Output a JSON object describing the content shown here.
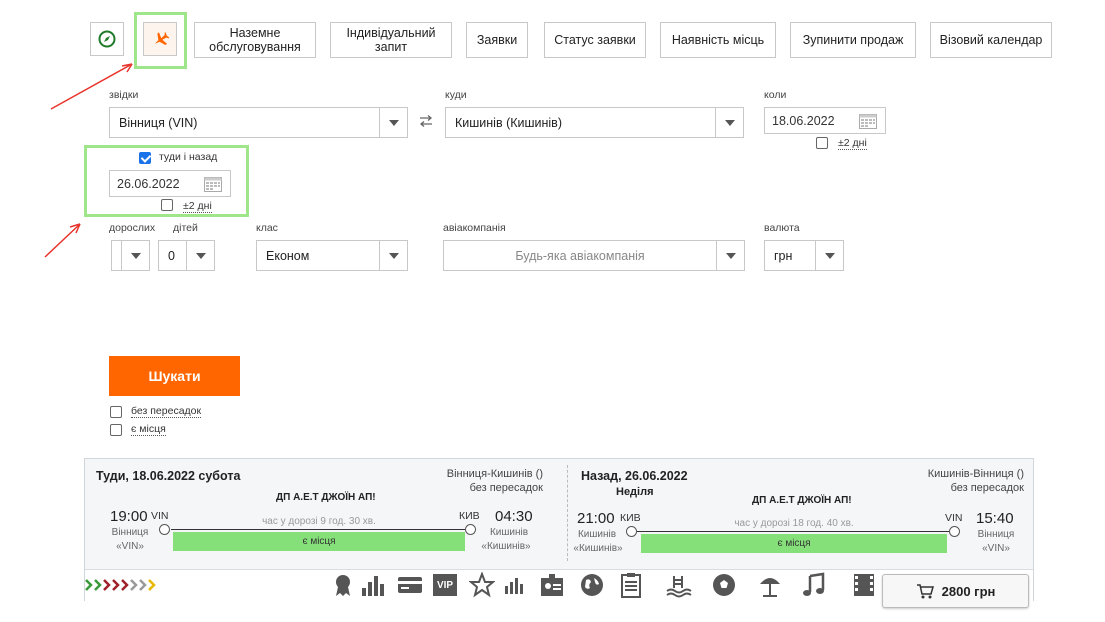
{
  "nav": {
    "ground": "Наземне обслуговування",
    "individual": "Індивідуальний запит",
    "requests": "Заявки",
    "status": "Статус заявки",
    "availability": "Наявність місць",
    "stop_sales": "Зупинити продаж",
    "visa": "Візовий календар"
  },
  "form": {
    "from_label": "звідки",
    "from_value": "Вінниця (VIN)",
    "to_label": "куди",
    "to_value": "Кишинів (Кишинів)",
    "when_label": "коли",
    "when_value": "18.06.2022",
    "flex_label": "±2 дні",
    "roundtrip_label": "туди і назад",
    "return_value": "26.06.2022",
    "return_flex_label": "±2 дні",
    "adults_label": "дорослих",
    "adults_value": "",
    "children_label": "дітей",
    "children_value": "0",
    "class_label": "клас",
    "class_value": "Економ",
    "airline_label": "авіакомпанія",
    "airline_value": "Будь-яка авіакомпанія",
    "currency_label": "валюта",
    "currency_value": "грн",
    "search_button": "Шукати",
    "direct_label": "без пересадок",
    "seats_label": "є місця"
  },
  "result": {
    "out": {
      "title": "Туди, 18.06.2022 субота",
      "route": "Вінниця-Кишинів ()",
      "transfers": "без пересадок",
      "company": "ДП А.Е.Т ДЖОЇН АП!",
      "dep_time": "19:00",
      "dep_code": "VIN",
      "dep_city": "Вінниця",
      "dep_airport": "«VIN»",
      "duration": "час у дорозі 9 год. 30 хв.",
      "arr_code": "КИВ",
      "arr_time": "04:30",
      "arr_city": "Кишинів",
      "arr_airport": "«Кишинів»",
      "seats": "є місця"
    },
    "back": {
      "title": "Назад, 26.06.2022",
      "weekday": "Неділя",
      "route": "Кишинів-Вінниця ()",
      "transfers": "без пересадок",
      "company": "ДП А.Е.Т ДЖОЇН АП!",
      "dep_time": "21:00",
      "dep_code": "КИВ",
      "dep_city": "Кишинів",
      "dep_airport": "«Кишинів»",
      "duration": "час у дорозі 18 год. 40 хв.",
      "arr_code": "VIN",
      "arr_time": "15:40",
      "arr_city": "Вінниця",
      "arr_airport": "«VIN»",
      "seats": "є місця"
    },
    "vip_label": "VIP",
    "price": "2800 грн"
  },
  "colors": {
    "accent": "#ff6600",
    "highlight": "#9fe68a",
    "seats": "#86e07a",
    "arrow": "#e8342c"
  }
}
